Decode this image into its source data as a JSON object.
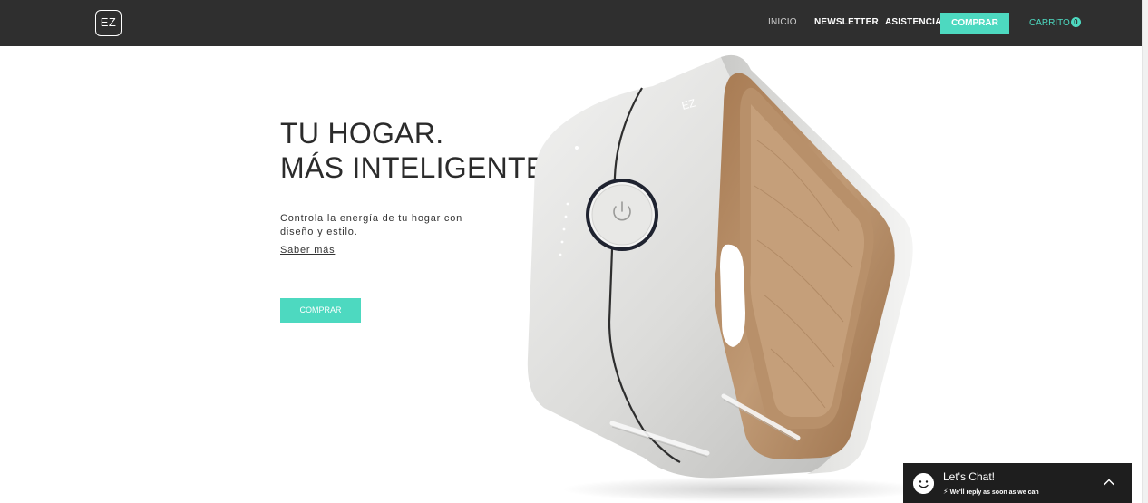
{
  "header": {
    "logo": "EZ",
    "nav": {
      "inicio": "INICIO",
      "newsletter": "NEWSLETTER",
      "asistencia": "ASISTENCIA",
      "comprar": "COMPRAR",
      "cart_label": "CARRITO",
      "cart_count": "0"
    }
  },
  "hero": {
    "headline_line1": "TU HOGAR.",
    "headline_line2": "MÁS INTELIGENTE.",
    "description": "Controla la energía de tu hogar con diseño y estilo.",
    "more_link": "Saber más",
    "buy_button": "COMPRAR",
    "product_logo": "EZ"
  },
  "chat": {
    "title": "Let's Chat!",
    "subtitle": "We'll reply as soon as we can",
    "icons": {
      "avatar": "smiley-icon",
      "bolt": "lightning-icon",
      "chevron": "chevron-up-icon"
    }
  },
  "colors": {
    "header_bg": "#2f2f2f",
    "accent": "#4dd9c0",
    "chat_bg": "#1e1e1e",
    "wood": "#b48a62"
  }
}
